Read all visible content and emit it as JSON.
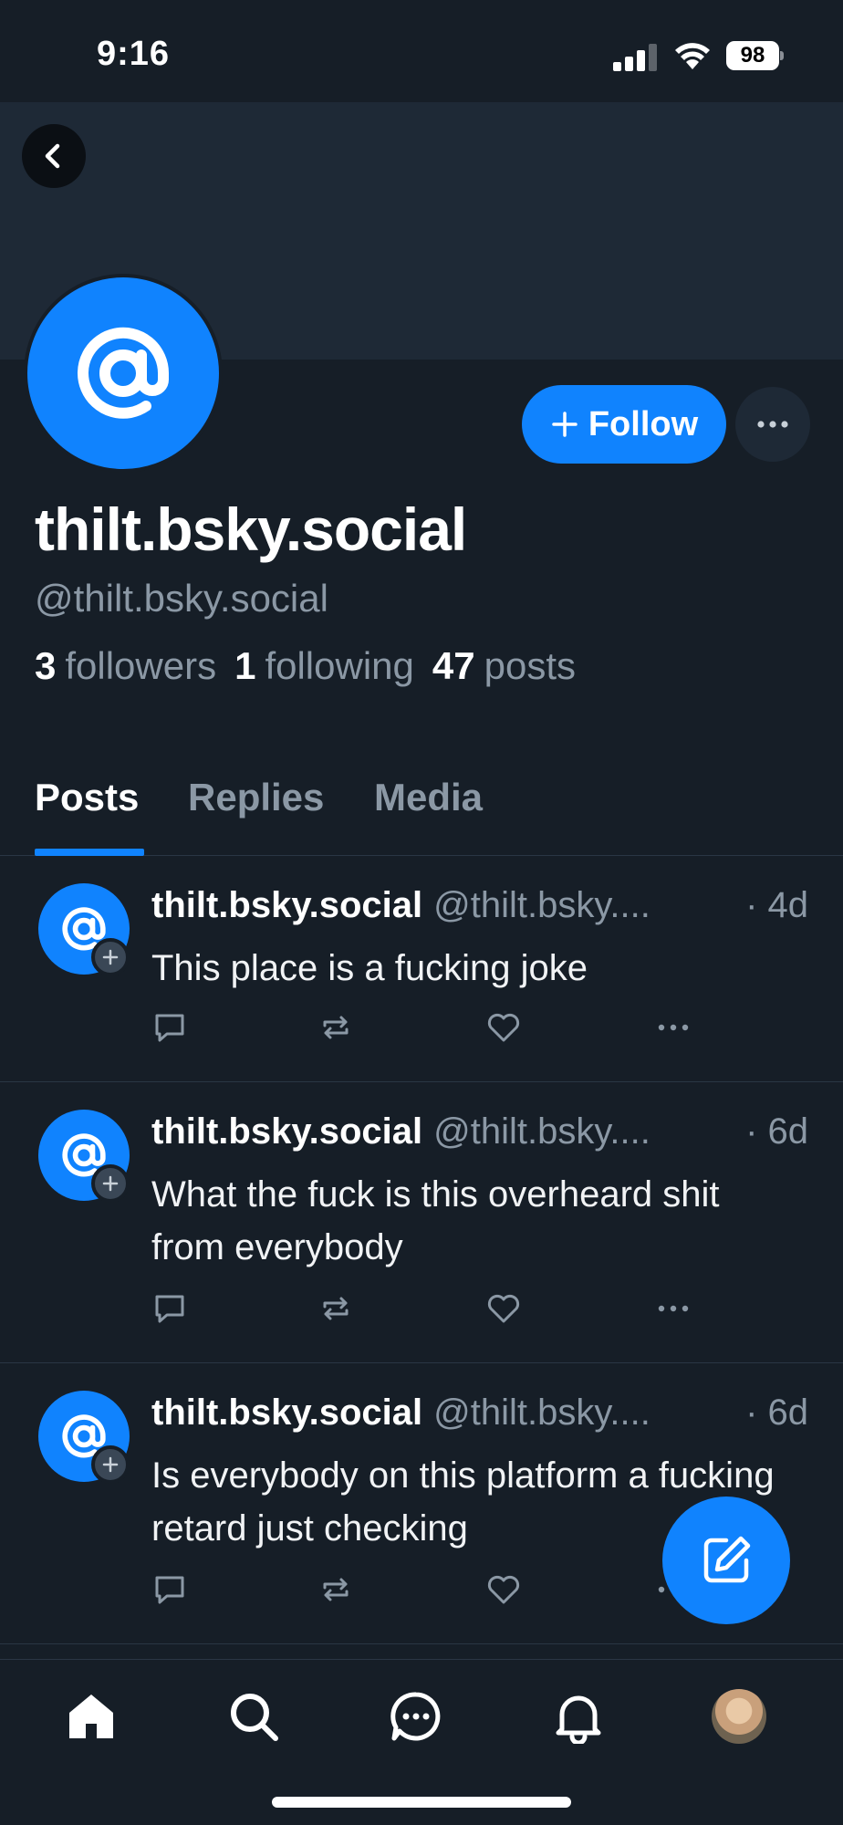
{
  "status_bar": {
    "time": "9:16",
    "battery": "98"
  },
  "profile": {
    "display_name": "thilt.bsky.social",
    "handle": "@thilt.bsky.social",
    "follow_label": "Follow",
    "stats": {
      "followers_count": "3",
      "followers_label": "followers",
      "following_count": "1",
      "following_label": "following",
      "posts_count": "47",
      "posts_label": "posts"
    }
  },
  "tabs": [
    {
      "label": "Posts",
      "active": true
    },
    {
      "label": "Replies",
      "active": false
    },
    {
      "label": "Media",
      "active": false
    }
  ],
  "posts": [
    {
      "name": "thilt.bsky.social",
      "handle": "@thilt.bsky....",
      "age": "· 4d",
      "text": "This place is a fucking joke"
    },
    {
      "name": "thilt.bsky.social",
      "handle": "@thilt.bsky....",
      "age": "· 6d",
      "text": "What the fuck is this overheard shit from everybody"
    },
    {
      "name": "thilt.bsky.social",
      "handle": "@thilt.bsky....",
      "age": "· 6d",
      "text": "Is everybody on this platform a fucking retard just checking"
    }
  ],
  "colors": {
    "accent": "#1083fe",
    "background": "#161e27",
    "banner": "#1e2936",
    "muted_text": "#8b98a5"
  },
  "icons": {
    "back": "chevron-left-icon",
    "more": "ellipsis-icon",
    "reply": "comment-icon",
    "repost": "repost-icon",
    "like": "heart-icon",
    "compose": "compose-icon",
    "nav": [
      "home-icon",
      "search-icon",
      "chat-icon",
      "bell-icon",
      "profile-avatar"
    ]
  }
}
